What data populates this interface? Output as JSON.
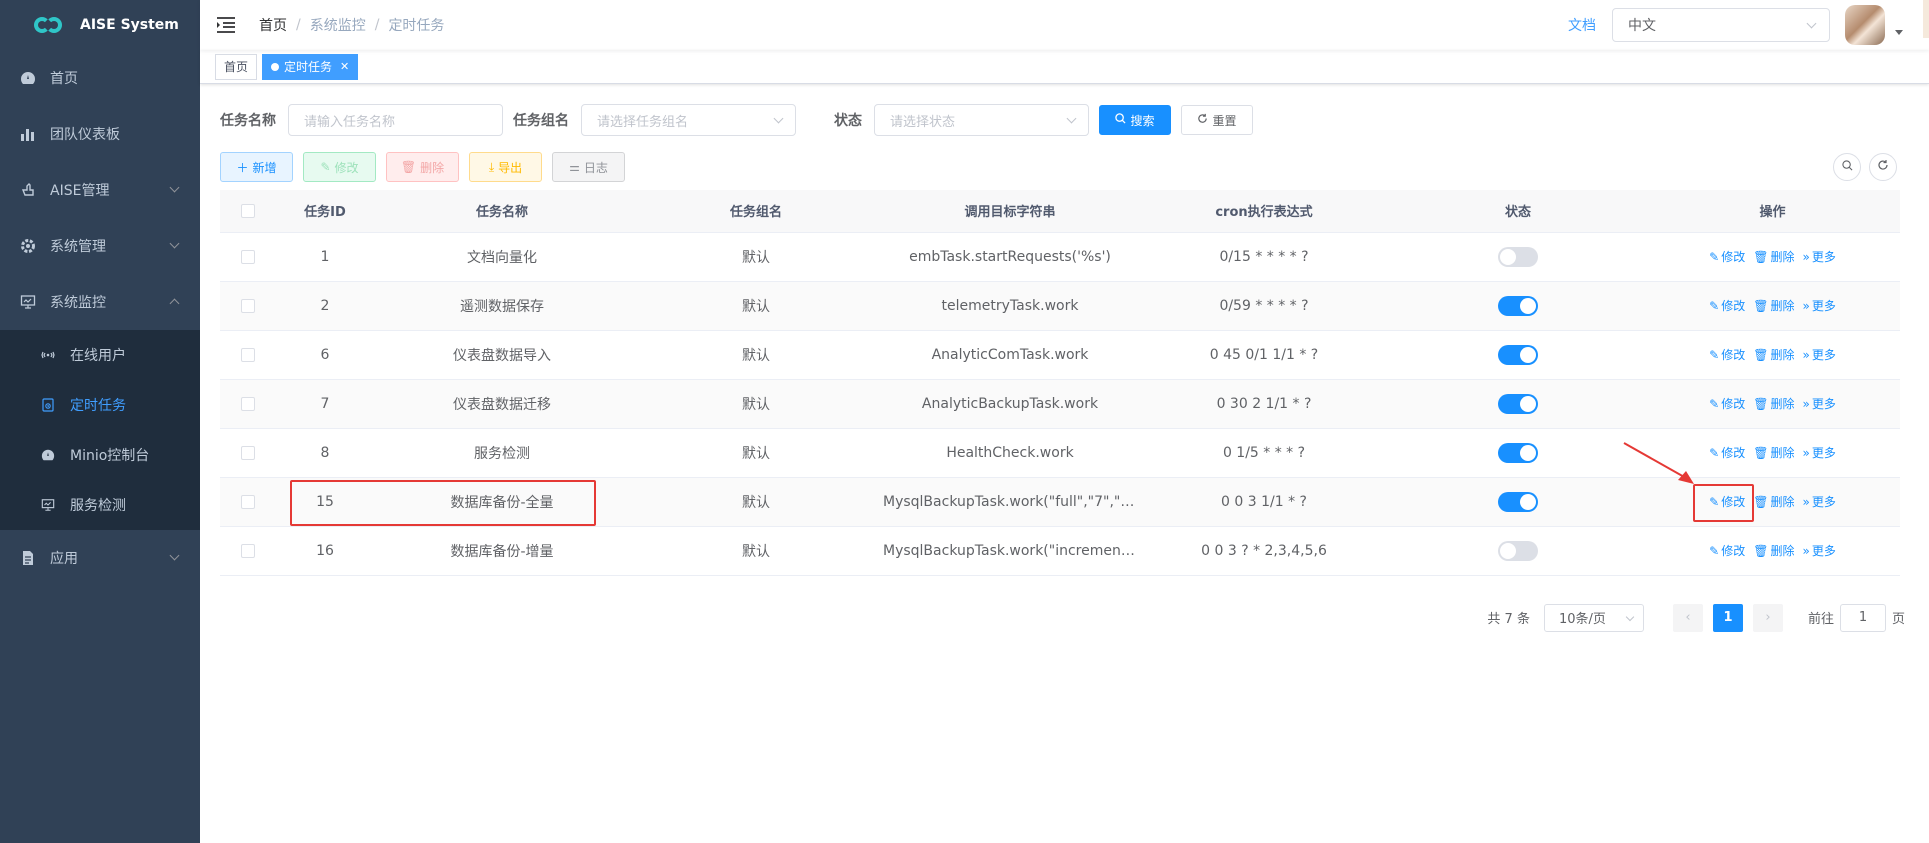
{
  "app": {
    "title": "AISE System"
  },
  "sidebar": {
    "items": [
      {
        "label": "首页",
        "icon": "dashboard-icon"
      },
      {
        "label": "团队仪表板",
        "icon": "bar-chart-icon"
      },
      {
        "label": "AISE管理",
        "icon": "hand-icon"
      },
      {
        "label": "系统管理",
        "icon": "gear-icon"
      },
      {
        "label": "系统监控",
        "icon": "monitor-icon"
      },
      {
        "label": "应用",
        "icon": "document-icon"
      }
    ],
    "monitor_sub": [
      {
        "label": "在线用户",
        "icon": "online-icon"
      },
      {
        "label": "定时任务",
        "icon": "job-icon",
        "active": true
      },
      {
        "label": "Minio控制台",
        "icon": "dashboard-icon"
      },
      {
        "label": "服务检测",
        "icon": "monitor-icon"
      }
    ]
  },
  "navbar": {
    "breadcrumb": [
      "首页",
      "系统监控",
      "定时任务"
    ],
    "doc_link": "文档",
    "language": "中文"
  },
  "tags": [
    {
      "label": "首页"
    },
    {
      "label": "定时任务",
      "active": true
    }
  ],
  "search": {
    "job_name_label": "任务名称",
    "job_name_placeholder": "请输入任务名称",
    "job_group_label": "任务组名",
    "job_group_placeholder": "请选择任务组名",
    "status_label": "状态",
    "status_placeholder": "请选择状态",
    "search_btn": "搜索",
    "reset_btn": "重置"
  },
  "toolbar": {
    "add": "新增",
    "edit": "修改",
    "delete": "删除",
    "export": "导出",
    "log": "日志"
  },
  "table": {
    "headers": [
      "任务ID",
      "任务名称",
      "任务组名",
      "调用目标字符串",
      "cron执行表达式",
      "状态",
      "操作"
    ],
    "rows": [
      {
        "id": "1",
        "name": "文档向量化",
        "group": "默认",
        "target": "embTask.startRequests('%s')",
        "cron": "0/15 * * * * ?",
        "enabled": false
      },
      {
        "id": "2",
        "name": "遥测数据保存",
        "group": "默认",
        "target": "telemetryTask.work",
        "cron": "0/59 * * * * ?",
        "enabled": true
      },
      {
        "id": "6",
        "name": "仪表盘数据导入",
        "group": "默认",
        "target": "AnalyticComTask.work",
        "cron": "0 45 0/1 1/1 * ?",
        "enabled": true
      },
      {
        "id": "7",
        "name": "仪表盘数据迁移",
        "group": "默认",
        "target": "AnalyticBackupTask.work",
        "cron": "0 30 2 1/1 * ?",
        "enabled": true
      },
      {
        "id": "8",
        "name": "服务检测",
        "group": "默认",
        "target": "HealthCheck.work",
        "cron": "0 1/5 * * * ?",
        "enabled": true
      },
      {
        "id": "15",
        "name": "数据库备份-全量",
        "group": "默认",
        "target": "MysqlBackupTask.work(\"full\",\"7\",\"a…",
        "cron": "0 0 3 1/1 * ?",
        "enabled": true
      },
      {
        "id": "16",
        "name": "数据库备份-增量",
        "group": "默认",
        "target": "MysqlBackupTask.work(\"increment…",
        "cron": "0 0 3 ? * 2,3,4,5,6",
        "enabled": false
      }
    ],
    "ops": {
      "edit": "修改",
      "delete": "删除",
      "more": "更多"
    }
  },
  "pagination": {
    "total": "共 7 条",
    "page_size": "10条/页",
    "current": "1",
    "goto_prefix": "前往",
    "goto_value": "1",
    "goto_suffix": "页"
  },
  "colors": {
    "primary": "#1890ff",
    "sidebar": "#304156",
    "annotation": "#e53935"
  }
}
